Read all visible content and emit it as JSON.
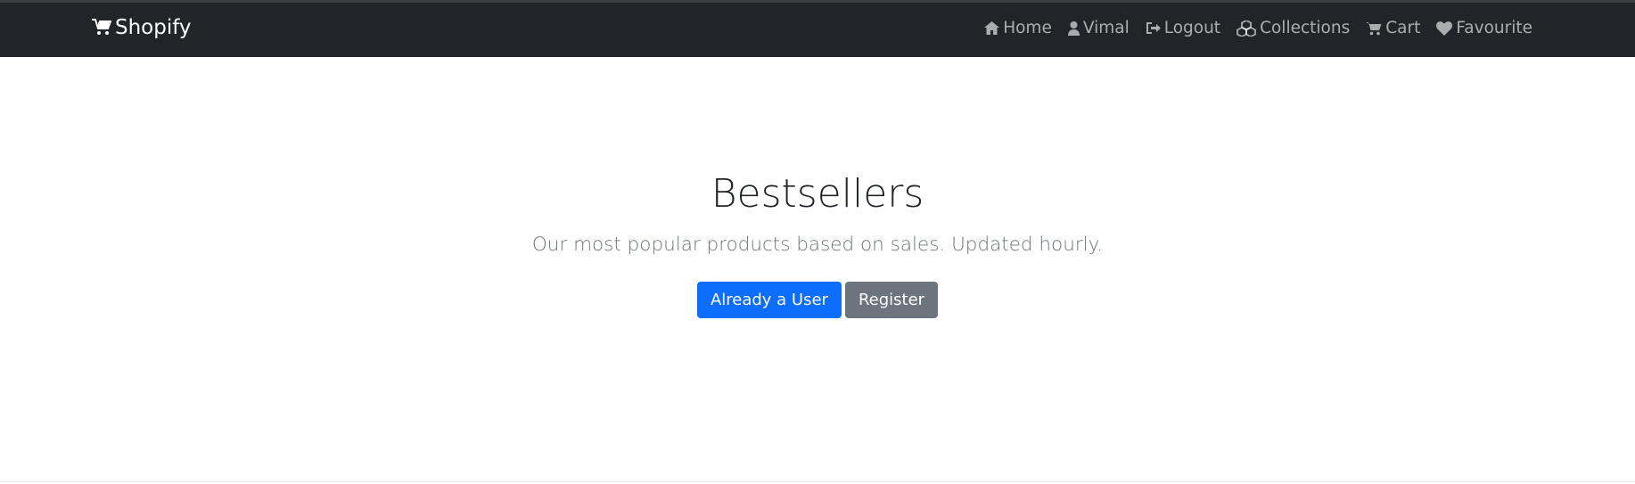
{
  "navbar": {
    "brand": "Shopify",
    "links": [
      {
        "label": "Home",
        "icon": "home-icon"
      },
      {
        "label": "Vimal",
        "icon": "user-icon"
      },
      {
        "label": "Logout",
        "icon": "sign-out-icon"
      },
      {
        "label": "Collections",
        "icon": "cubes-icon"
      },
      {
        "label": "Cart",
        "icon": "cart-icon"
      },
      {
        "label": "Favourite",
        "icon": "heart-icon"
      }
    ]
  },
  "hero": {
    "title": "Bestsellers",
    "subtitle": "Our most popular products based on sales. Updated hourly.",
    "primary_button": "Already a User",
    "secondary_button": "Register"
  },
  "colors": {
    "navbar_bg": "#212529",
    "primary": "#0d6efd",
    "secondary": "#6c757d"
  }
}
